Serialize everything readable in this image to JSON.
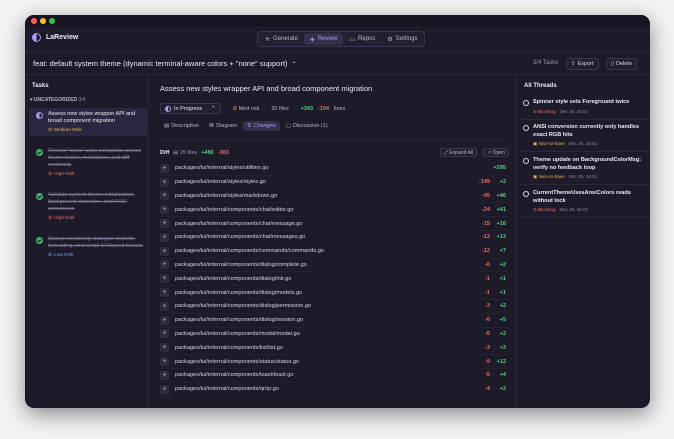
{
  "app": {
    "name": "LaReview"
  },
  "nav": [
    {
      "label": "Generate",
      "icon": "✳",
      "active": false
    },
    {
      "label": "Review",
      "icon": "◈",
      "active": true
    },
    {
      "label": "Repos",
      "icon": "▭",
      "active": false
    },
    {
      "label": "Settings",
      "icon": "⚙",
      "active": false
    }
  ],
  "taskbar": {
    "title": "feat: default system theme (dynamic terminal-aware colors + \"none\" support)",
    "chevron": "⌃",
    "count": "3/4 Tasks",
    "export_label": "Export",
    "delete_label": "Delete"
  },
  "sidebar": {
    "heading": "Tasks",
    "group_label": "UNCATEGORIZED",
    "group_count": "3/4",
    "tasks": [
      {
        "title": "Assess new styles wrapper API and broad component migration",
        "risk": "Medium Risk",
        "status": "in-progress"
      },
      {
        "title": "Review \"none\" color semantics across theme loader, markdown, and diff rendering",
        "risk": "High Risk",
        "status": "done"
      },
      {
        "title": "Validate system theme initialization, background detection, and ANSI conversion",
        "risk": "High Risk",
        "status": "done"
      },
      {
        "title": "Sweep remaining changes: imports, formatting, and small UX/layout tweaks",
        "risk": "Low Risk",
        "status": "done"
      }
    ]
  },
  "main": {
    "title": "Assess new styles wrapper API and broad component migration",
    "status": "In Progress",
    "risk": "Med risk",
    "files": "20 files",
    "additions": "+343",
    "deletions": "-194",
    "lines_label": "lines",
    "tabs": [
      {
        "label": "Description",
        "active": false
      },
      {
        "label": "Diagram",
        "active": false
      },
      {
        "label": "Changes",
        "active": true
      },
      {
        "label": "Discussion (1)",
        "active": false
      }
    ],
    "diff": {
      "label": "Diff",
      "files": "20 files",
      "additions": "+480",
      "deletions": "-303",
      "expand_label": "Expand All",
      "open_label": "Open",
      "rows": [
        {
          "path": "packages/tui/internal/styles/utilities.go",
          "del": "",
          "add": "+295"
        },
        {
          "path": "packages/tui/internal/styles/styles.go",
          "del": "-149",
          "add": "+2"
        },
        {
          "path": "packages/tui/internal/styles/markdown.go",
          "del": "-45",
          "add": "+46"
        },
        {
          "path": "packages/tui/internal/components/chat/editor.go",
          "del": "-24",
          "add": "+41"
        },
        {
          "path": "packages/tui/internal/components/chat/message.go",
          "del": "-15",
          "add": "+16"
        },
        {
          "path": "packages/tui/internal/components/chat/messages.go",
          "del": "-13",
          "add": "+13"
        },
        {
          "path": "packages/tui/internal/components/commands/commands.go",
          "del": "-12",
          "add": "+7"
        },
        {
          "path": "packages/tui/internal/components/dialog/complete.go",
          "del": "-6",
          "add": "+2"
        },
        {
          "path": "packages/tui/internal/components/dialog/init.go",
          "del": "-1",
          "add": "+1"
        },
        {
          "path": "packages/tui/internal/components/dialog/models.go",
          "del": "-1",
          "add": "+1"
        },
        {
          "path": "packages/tui/internal/components/dialog/permission.go",
          "del": "-3",
          "add": "+2"
        },
        {
          "path": "packages/tui/internal/components/dialog/session.go",
          "del": "-6",
          "add": "+5"
        },
        {
          "path": "packages/tui/internal/components/modal/modal.go",
          "del": "-5",
          "add": "+2"
        },
        {
          "path": "packages/tui/internal/components/list/list.go",
          "del": "-3",
          "add": "+3"
        },
        {
          "path": "packages/tui/internal/components/status/status.go",
          "del": "-9",
          "add": "+12"
        },
        {
          "path": "packages/tui/internal/components/toast/toast.go",
          "del": "-5",
          "add": "+4"
        },
        {
          "path": "packages/tui/internal/components/qr/qr.go",
          "del": "-4",
          "add": "+2"
        }
      ]
    }
  },
  "threads": {
    "heading": "All Threads",
    "items": [
      {
        "title": "Spinner style sets Foreground twice",
        "tag": "Blocking",
        "date": "Dec 26, 16:01"
      },
      {
        "title": "ANSI conversion currently only handles exact RGB hits",
        "tag": "Nice-to-have",
        "date": "Dec 26, 16:01"
      },
      {
        "title": "Theme update on BackgroundColorMsg: verify no feedback loop",
        "tag": "Nice-to-have",
        "date": "Dec 26, 16:01"
      },
      {
        "title": "CurrentThemeUsesAnsiColors reads without lock",
        "tag": "Blocking",
        "date": "Dec 26, 16:01"
      }
    ]
  }
}
